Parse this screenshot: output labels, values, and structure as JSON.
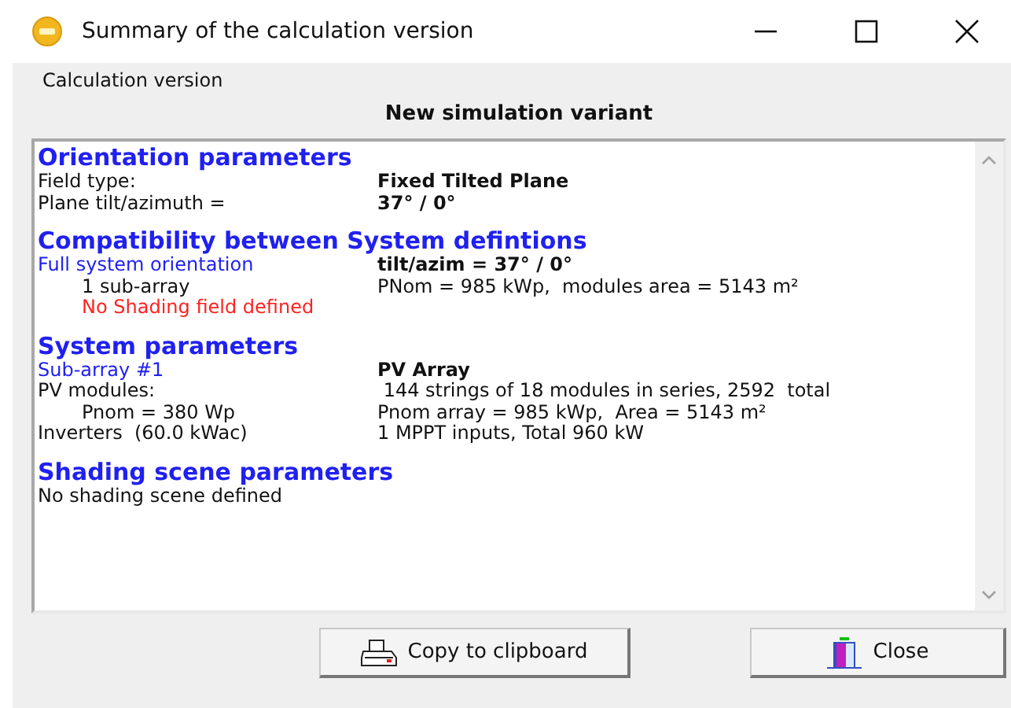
{
  "window": {
    "title": "Summary of the calculation version"
  },
  "group_label": "Calculation version",
  "variant_title": "New simulation variant",
  "report": [
    {
      "kind": "heading",
      "text": "Orientation parameters"
    },
    {
      "kind": "row",
      "label": {
        "text": "Field type:",
        "color": "#111111"
      },
      "value": "Fixed Tilted Plane",
      "value_bold": true
    },
    {
      "kind": "row",
      "label": {
        "text": "Plane tilt/azimuth =",
        "color": "#111111"
      },
      "value": "37° / 0°",
      "value_bold": true
    },
    {
      "kind": "gap"
    },
    {
      "kind": "heading",
      "text": "Compatibility between System defintions"
    },
    {
      "kind": "row",
      "label": {
        "text": "Full system orientation",
        "color": "#2020f0"
      },
      "value": "tilt/azim = 37° / 0°",
      "value_bold": true,
      "children": [
        {
          "label": {
            "text": "1 sub-array",
            "color": "#111111"
          },
          "value": "PNom = 985 kWp,  modules area = 5143 m²",
          "value_bold": false
        },
        {
          "label": {
            "text": "No Shading field defined",
            "color": "#ff2020"
          }
        }
      ]
    },
    {
      "kind": "gap"
    },
    {
      "kind": "heading",
      "text": "System parameters"
    },
    {
      "kind": "row",
      "label": {
        "text": "Sub-array #1",
        "color": "#2020f0"
      },
      "value": "PV Array",
      "value_bold": true
    },
    {
      "kind": "row",
      "label": {
        "text": "PV modules:",
        "color": "#111111"
      },
      "value": " 144 strings of 18 modules in series, 2592  total",
      "value_bold": false,
      "children": [
        {
          "label": {
            "text": "Pnom = 380 Wp",
            "color": "#111111"
          },
          "value": "Pnom array = 985 kWp,  Area = 5143 m²",
          "value_bold": false
        }
      ]
    },
    {
      "kind": "row",
      "label": {
        "text": "Inverters  (60.0 kWac)",
        "color": "#111111"
      },
      "value": "1 MPPT inputs, Total 960 kW",
      "value_bold": false
    },
    {
      "kind": "gap"
    },
    {
      "kind": "heading",
      "text": "Shading scene parameters"
    },
    {
      "kind": "row",
      "label": {
        "text": "No shading scene defined",
        "color": "#111111"
      }
    }
  ],
  "buttons": [
    {
      "kind": "copy",
      "label": "Copy to clipboard"
    },
    {
      "kind": "close",
      "label": "Close"
    }
  ]
}
